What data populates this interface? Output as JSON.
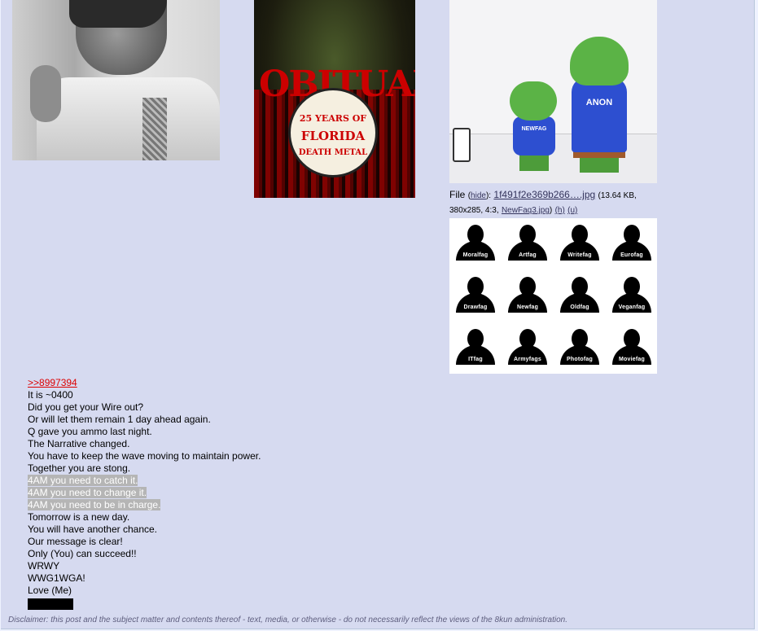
{
  "post": {
    "images": [
      {
        "name": "jfk-photo"
      },
      {
        "name": "obituary-poster",
        "logo_text": "OBITUARY",
        "seal_text_1": "25 YEARS OF",
        "seal_text_2": "FLORIDA",
        "seal_text_3": "DEATH METAL"
      },
      {
        "name": "pepe-newfag-anon",
        "labels": [
          "NEWFAG",
          "ANON"
        ]
      }
    ],
    "file": {
      "label": "File",
      "hide": "hide",
      "filename": "1f491f2e369b266….jpg",
      "size": "(13.64 KB,",
      "dims": "380x285, 4:3,",
      "orig_name": "NewFaq3.jpg",
      "h": "(h)",
      "u": "(u)"
    },
    "grid": {
      "labels": [
        "Moralfag",
        "Artfag",
        "Writefag",
        "Eurofag",
        "Drawfag",
        "Newfag",
        "Oldfag",
        "Veganfag",
        "ITfag",
        "Armyfags",
        "Photofag",
        "Moviefag"
      ]
    },
    "body": {
      "quote_link": ">>8997394",
      "lines": [
        "It is ~0400",
        "Did you get your Wire out?",
        "Or will let them remain 1 day ahead again.",
        "Q gave you ammo last night.",
        "The Narrative changed.",
        "You have to keep the wave moving to maintain power.",
        "Together you are stong."
      ],
      "highlighted": [
        "4AM you need to catch it.",
        "4AM you need to change it.",
        "4AM you need to be in charge."
      ],
      "lines2": [
        "Tomorrow is a new day.",
        "You will have another chance.",
        "Our message is clear!",
        "Only (You) can succeed!!",
        "WRWY",
        "WWG1WGA!",
        "Love (Me)"
      ]
    },
    "disclaimer": "Disclaimer: this post and the subject matter and contents thereof - text, media, or otherwise - do not necessarily reflect the views of the 8kun administration."
  }
}
